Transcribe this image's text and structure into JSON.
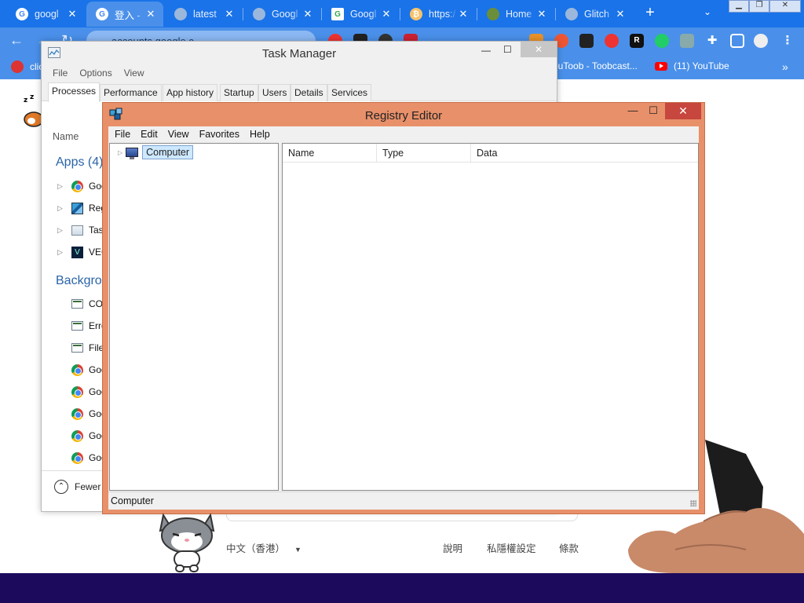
{
  "browser": {
    "tabs": [
      {
        "title": "googl",
        "favicon": "google-g",
        "active": false
      },
      {
        "title": "登入 - ",
        "favicon": "google-g",
        "active": true
      },
      {
        "title": "latest",
        "favicon": "globe",
        "active": false
      },
      {
        "title": "Googl",
        "favicon": "globe",
        "active": false
      },
      {
        "title": "Googl",
        "favicon": "google-color",
        "active": false
      },
      {
        "title": "https:/",
        "favicon": "bitcoin",
        "active": false
      },
      {
        "title": "Home",
        "favicon": "home",
        "active": false
      },
      {
        "title": "Glitch",
        "favicon": "globe",
        "active": false
      }
    ],
    "close_glyph": "✕",
    "new_tab_glyph": "+",
    "tab_search_glyph": "⌄",
    "url": "accounts.google.c",
    "bookmarks": [
      {
        "label": "clic",
        "icon": "red-x-icon"
      },
      {
        "label": "ouToob - Toobcast...",
        "icon": ""
      },
      {
        "label": "(11) YouTube",
        "icon": "youtube-icon"
      }
    ],
    "more_bookmarks_glyph": "»",
    "accent_color": "#1a73e8"
  },
  "task_manager": {
    "title": "Task Manager",
    "menu": [
      "File",
      "Options",
      "View"
    ],
    "tabs": [
      "Processes",
      "Performance",
      "App history",
      "Startup",
      "Users",
      "Details",
      "Services"
    ],
    "active_tab": "Processes",
    "column_name": "Name",
    "apps_group": "Apps (4)",
    "apps": [
      {
        "name": "Goo",
        "icon": "chrome-icon"
      },
      {
        "name": "Reg",
        "icon": "registry-icon"
      },
      {
        "name": "Tas",
        "icon": "task-manager-icon"
      },
      {
        "name": "VEG",
        "icon": "vegas-icon"
      }
    ],
    "background_group": "Backgrou",
    "background": [
      {
        "name": "COI",
        "icon": "window-icon"
      },
      {
        "name": "Erro",
        "icon": "window-icon"
      },
      {
        "name": "File",
        "icon": "window-icon"
      },
      {
        "name": "Goo",
        "icon": "chrome-icon"
      },
      {
        "name": "Goo",
        "icon": "chrome-icon"
      },
      {
        "name": "Goo",
        "icon": "chrome-icon"
      },
      {
        "name": "Goo",
        "icon": "chrome-icon"
      },
      {
        "name": "Goo",
        "icon": "chrome-icon"
      }
    ],
    "fewer_details": "Fewer d"
  },
  "registry_editor": {
    "title": "Registry Editor",
    "menu": [
      "File",
      "Edit",
      "View",
      "Favorites",
      "Help"
    ],
    "tree_root": "Computer",
    "columns": [
      "Name",
      "Type",
      "Data"
    ],
    "status": "Computer",
    "frame_color": "#e8906a"
  },
  "page": {
    "language": "中文（香港）",
    "links": [
      "說明",
      "私隱權設定",
      "條款"
    ]
  }
}
